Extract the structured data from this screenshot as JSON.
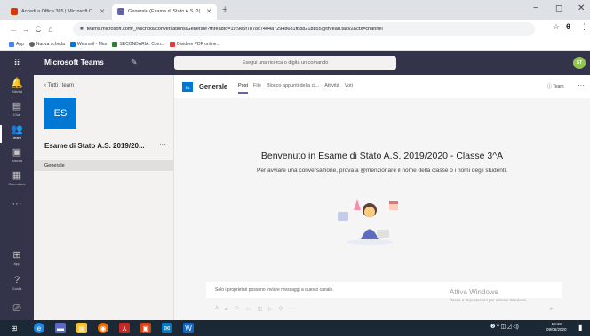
{
  "browser": {
    "tabs": [
      {
        "title": "Accedi a Office 365 | Microsoft O",
        "active": false
      },
      {
        "title": "Generale (Esame di Stato A.S. 2(",
        "active": true
      }
    ],
    "new_tab": "+",
    "window_controls": {
      "minimize": "−",
      "maximize": "◻",
      "close": "✕"
    },
    "address": {
      "host": "teams.microsoft.com",
      "path": "/_#/school/conversations/Generale?threadId=19:9e5f7878c7404a7294b681fb88218b55@thread.tacv2&ctx=channel"
    },
    "bookmarks": [
      "App",
      "Nuova scheda",
      "Webmail - Miur",
      "SECONDARIA: Com...",
      "Dividere PDF online..."
    ]
  },
  "teams_header": {
    "brand": "Microsoft Teams",
    "search_placeholder": "Esegui una ricerca o digita un comando",
    "avatar_initials": "ST"
  },
  "rail": [
    {
      "icon": "bell-icon",
      "label": "Attività",
      "glyph": "🔔"
    },
    {
      "icon": "chat-icon",
      "label": "Chat",
      "glyph": "▤"
    },
    {
      "icon": "teams-icon",
      "label": "Team",
      "glyph": "👥"
    },
    {
      "icon": "assignments-icon",
      "label": "Attività",
      "glyph": "▣"
    },
    {
      "icon": "calendar-icon",
      "label": "Calendario",
      "glyph": "▦"
    },
    {
      "icon": "more-icon",
      "label": "",
      "glyph": "···"
    },
    {
      "icon": "apps-icon",
      "label": "App",
      "glyph": "⊞"
    },
    {
      "icon": "help-icon",
      "label": "Guida",
      "glyph": "?"
    },
    {
      "icon": "device-icon",
      "label": "",
      "glyph": "⎚"
    }
  ],
  "team_panel": {
    "back_label": "Tutti i team",
    "team_initials": "ES",
    "team_name": "Esame di Stato A.S. 2019/20...",
    "more": "···",
    "channel": "Generale"
  },
  "channel": {
    "tile": "Es",
    "name": "Generale",
    "tabs": [
      "Post",
      "File",
      "Blocco appunti della cl...",
      "Attività",
      "Voti"
    ],
    "active_tab": "Post",
    "team_button": "Team",
    "more": "···"
  },
  "welcome": {
    "title": "Benvenuto in Esame di Stato A.S. 2019/2020 - Classe 3^A",
    "subtitle": "Per avviare una conversazione, prova a @menzionare il nome della classe o i nomi degli studenti."
  },
  "composer": {
    "placeholder": "Solo i proprietari possono inviare messaggi a questo canale.",
    "tools": [
      "A",
      "⌀",
      "☺",
      "▭",
      "◫",
      "▷",
      "⚲",
      "···"
    ],
    "send": "➤"
  },
  "watermark": {
    "title": "Attiva Windows",
    "subtitle": "Passa a Impostazioni per attivare Windows."
  },
  "taskbar": {
    "tray": "❷ ^ ◫ ◿ ◁)",
    "time": "18:19",
    "date": "09/06/2020"
  },
  "colors": {
    "teams_dark": "#33344a",
    "accent": "#6264a7",
    "team_tile": "#0078d4"
  }
}
